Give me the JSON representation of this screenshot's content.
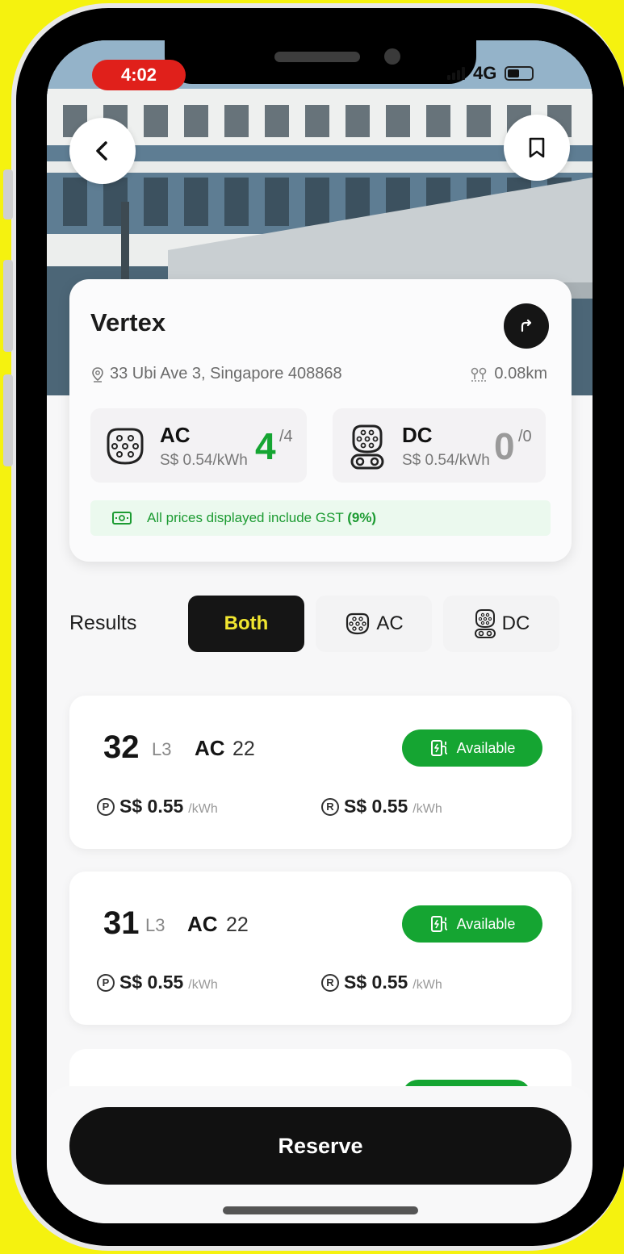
{
  "status_bar": {
    "time": "4:02",
    "network": "4G"
  },
  "station": {
    "name": "Vertex",
    "address": "33 Ubi Ave 3, Singapore 408868",
    "distance": "0.08km"
  },
  "chargers": {
    "ac": {
      "type": "AC",
      "price": "S$ 0.54/kWh",
      "available": "4",
      "total": "/4"
    },
    "dc": {
      "type": "DC",
      "price": "S$ 0.54/kWh",
      "available": "0",
      "total": "/0"
    }
  },
  "gst_notice": {
    "text": "All prices displayed include GST ",
    "rate": "(9%)"
  },
  "filters": {
    "label": "Results",
    "options": [
      "Both",
      "AC",
      "DC"
    ],
    "selected": "Both"
  },
  "results": [
    {
      "number": "32",
      "level": "L3",
      "type": "AC",
      "power": "22",
      "status": "Available",
      "price_1": "S$ 0.55",
      "price_2": "S$ 0.55",
      "unit": "/kWh",
      "icon_1": "P",
      "icon_2": "R"
    },
    {
      "number": "31",
      "level": "L3",
      "type": "AC",
      "power": "22",
      "status": "Available",
      "price_1": "S$ 0.55",
      "price_2": "S$ 0.55",
      "unit": "/kWh",
      "icon_1": "P",
      "icon_2": "R"
    }
  ],
  "actions": {
    "reserve": "Reserve"
  },
  "colors": {
    "accent_green": "#15a532",
    "chip_active_text": "#f1e630",
    "dark": "#151515",
    "status_red": "#e0201b"
  }
}
